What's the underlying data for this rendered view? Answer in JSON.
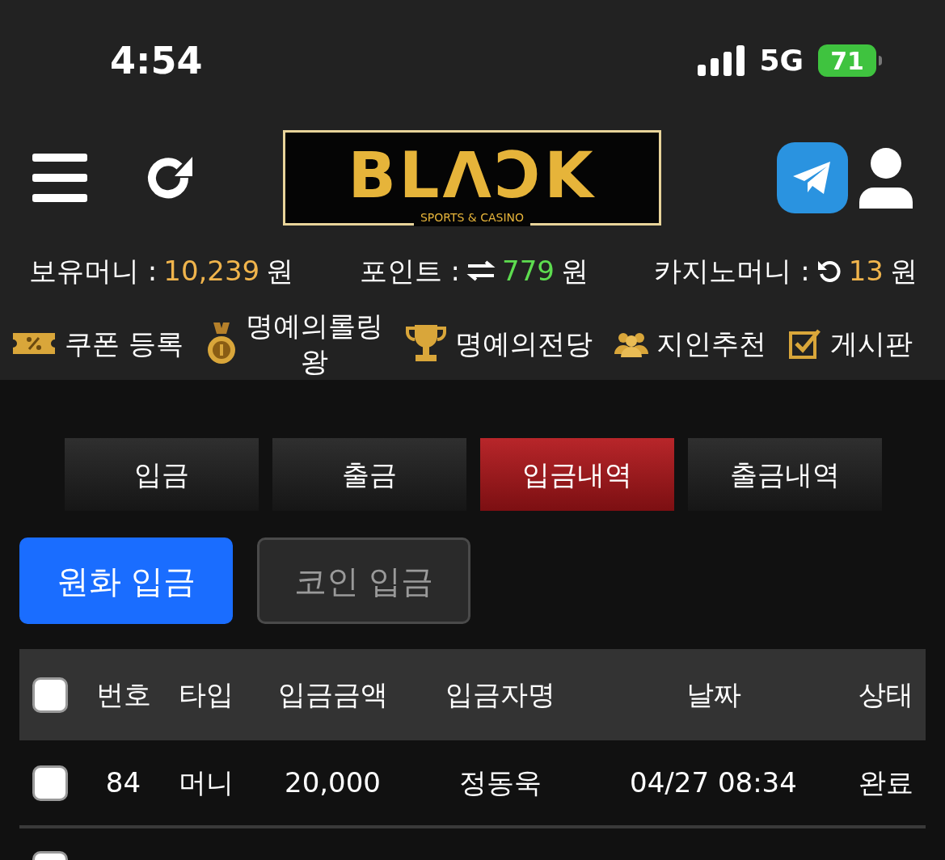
{
  "status_bar": {
    "time": "4:54",
    "network": "5G",
    "battery": "71"
  },
  "header": {
    "logo": "BLΛƆK",
    "logo_sub": "SPORTS & CASINO"
  },
  "balances": [
    {
      "label": "보유머니 :",
      "value": "10,239",
      "unit": "원",
      "color": "#f0b44c",
      "kind": "plain"
    },
    {
      "label": "포인트 :",
      "value": "779",
      "unit": "원",
      "color": "#5ddc4f",
      "kind": "exchange"
    },
    {
      "label": "카지노머니 :",
      "value": "13",
      "unit": "원",
      "color": "#f0b44c",
      "kind": "refresh"
    }
  ],
  "menu": [
    {
      "label": "쿠폰 등록",
      "kind": "coupon"
    },
    {
      "label": "명예의롤링왕",
      "kind": "medal"
    },
    {
      "label": "명예의전당",
      "kind": "trophy"
    },
    {
      "label": "지인추천",
      "kind": "people"
    },
    {
      "label": "게시판",
      "kind": "board"
    }
  ],
  "tabs": [
    {
      "label": "입금",
      "selected": false
    },
    {
      "label": "출금",
      "selected": false
    },
    {
      "label": "입금내역",
      "selected": true
    },
    {
      "label": "출금내역",
      "selected": false
    }
  ],
  "deposit_types": [
    {
      "label": "원화 입금",
      "selected": true
    },
    {
      "label": "코인 입금",
      "selected": false
    }
  ],
  "table": {
    "select_all": {
      "checked": false
    },
    "columns": [
      "번호",
      "타입",
      "입금금액",
      "입금자명",
      "날짜",
      "상태"
    ],
    "rows": [
      {
        "checked": false,
        "cells": [
          "84",
          "머니",
          "20,000",
          "정동욱",
          "04/27 08:34",
          "완료"
        ]
      }
    ],
    "next_row_checkbox": {
      "checked": false
    }
  }
}
